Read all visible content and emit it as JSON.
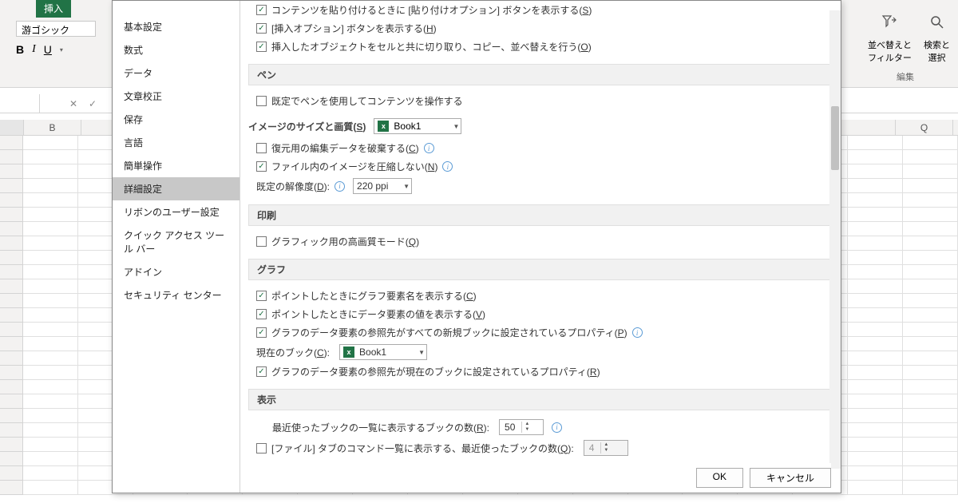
{
  "ribbon": {
    "tab_insert": "挿入",
    "font_name": "游ゴシック",
    "sort_filter": "並べ替えと\nフィルター",
    "find_select": "検索と\n選択",
    "edit_group": "編集"
  },
  "columns": {
    "b": "B",
    "q": "Q"
  },
  "nav": {
    "items": [
      "基本設定",
      "数式",
      "データ",
      "文章校正",
      "保存",
      "言語",
      "簡単操作",
      "詳細設定",
      "リボンのユーザー設定",
      "クイック アクセス ツール バー",
      "アドイン",
      "セキュリティ センター"
    ],
    "selected_index": 7
  },
  "opts": {
    "paste_options": "コンテンツを貼り付けるときに [貼り付けオプション] ボタンを表示する(",
    "paste_options_k": "S",
    "insert_options": "[挿入オプション] ボタンを表示する(",
    "insert_options_k": "H",
    "insert_obj": "挿入したオブジェクトをセルと共に切り取り、コピー、並べ替えを行う(",
    "insert_obj_k": "O",
    "pen_header": "ペン",
    "pen_default": "既定でペンを使用してコンテンツを操作する",
    "img_header": "イメージのサイズと画質(",
    "img_header_k": "S",
    "img_book": "Book1",
    "discard_edit": "復元用の編集データを破棄する(",
    "discard_edit_k": "C",
    "no_compress": "ファイル内のイメージを圧縮しない(",
    "no_compress_k": "N",
    "default_res": "既定の解像度(",
    "default_res_k": "D",
    "default_res_val": "220 ppi",
    "print_header": "印刷",
    "print_hq": "グラフィック用の高画質モード(",
    "print_hq_k": "Q",
    "chart_header": "グラフ",
    "chart_name": "ポイントしたときにグラフ要素名を表示する(",
    "chart_name_k": "C",
    "chart_val": "ポイントしたときにデータ要素の値を表示する(",
    "chart_val_k": "V",
    "chart_prop_all": "グラフのデータ要素の参照先がすべての新規ブックに設定されているプロパティ(",
    "chart_prop_all_k": "P",
    "current_book_lbl": "現在のブック(",
    "current_book_k": "C",
    "current_book_val": "Book1",
    "chart_prop_cur": "グラフのデータ要素の参照先が現在のブックに設定されているプロパティ(",
    "chart_prop_cur_k": "R",
    "disp_header": "表示",
    "recent_books": "最近使ったブックの一覧に表示するブックの数(",
    "recent_books_k": "R",
    "recent_books_val": "50",
    "recent_cmds": "[ファイル] タブのコマンド一覧に表示する、最近使ったブックの数(",
    "recent_cmds_k": "Q",
    "recent_cmds_val": "4"
  },
  "buttons": {
    "ok": "OK",
    "cancel": "キャンセル"
  }
}
